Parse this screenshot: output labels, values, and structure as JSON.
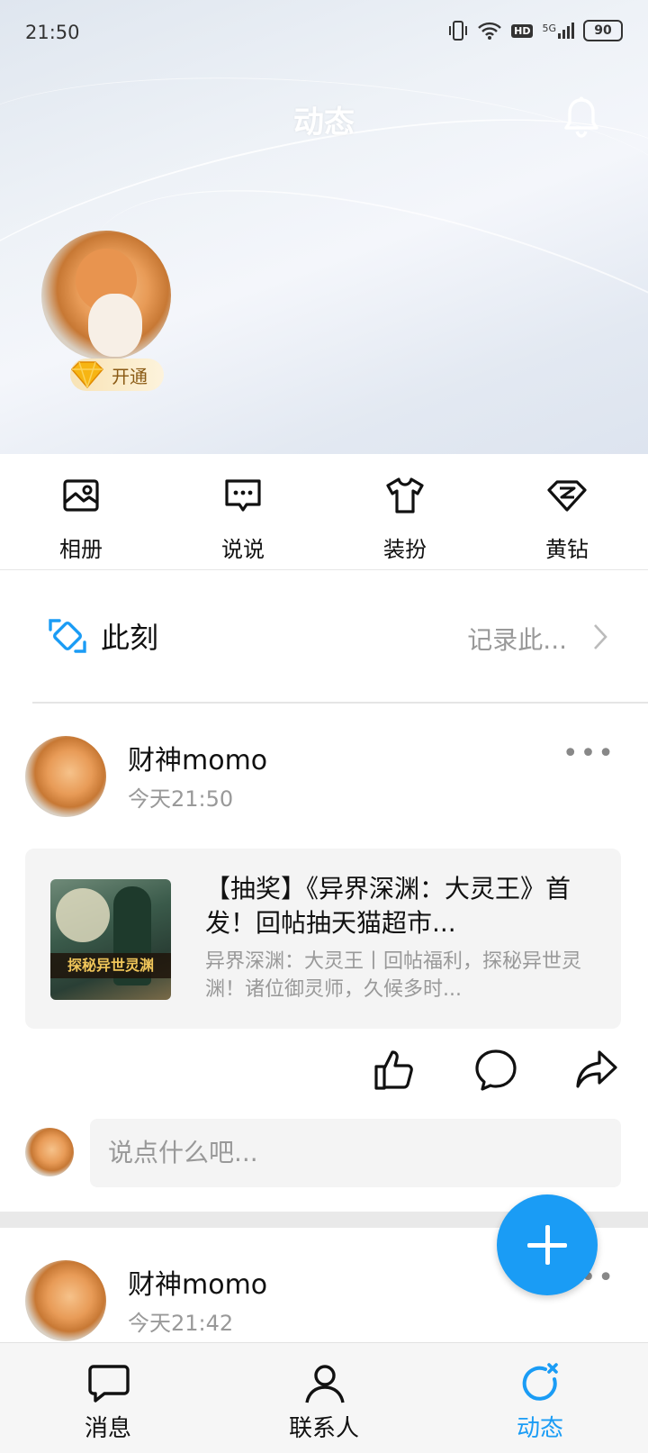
{
  "status_bar": {
    "time": "21:50",
    "network": "5G",
    "hd": "HD",
    "battery": "90"
  },
  "header": {
    "title": "动态",
    "vip_label": "开通"
  },
  "quick_menu": [
    {
      "label": "相册",
      "icon": "album-icon"
    },
    {
      "label": "说说",
      "icon": "message-box-icon"
    },
    {
      "label": "装扮",
      "icon": "tshirt-icon"
    },
    {
      "label": "黄钻",
      "icon": "yellow-diamond-icon"
    }
  ],
  "moment": {
    "title": "此刻",
    "hint": "记录此..."
  },
  "posts": [
    {
      "name": "财神momo",
      "time": "今天21:50",
      "more": "•••",
      "card": {
        "thumb_text": "探秘异世灵渊",
        "title": "【抽奖】《异界深渊：大灵王》首发！回帖抽天猫超市...",
        "desc": "异界深渊：大灵王丨回帖福利，探秘异世灵渊！诸位御灵师，久候多时..."
      }
    },
    {
      "name": "财神momo",
      "time": "今天21:42",
      "more": "•••"
    }
  ],
  "comment": {
    "placeholder": "说点什么吧..."
  },
  "bottom_nav": [
    {
      "label": "消息",
      "icon": "chat-bubble-icon"
    },
    {
      "label": "联系人",
      "icon": "contacts-icon"
    },
    {
      "label": "动态",
      "icon": "feed-refresh-icon",
      "active": true
    }
  ],
  "colors": {
    "accent": "#1a9cf5",
    "muted": "#999999"
  }
}
